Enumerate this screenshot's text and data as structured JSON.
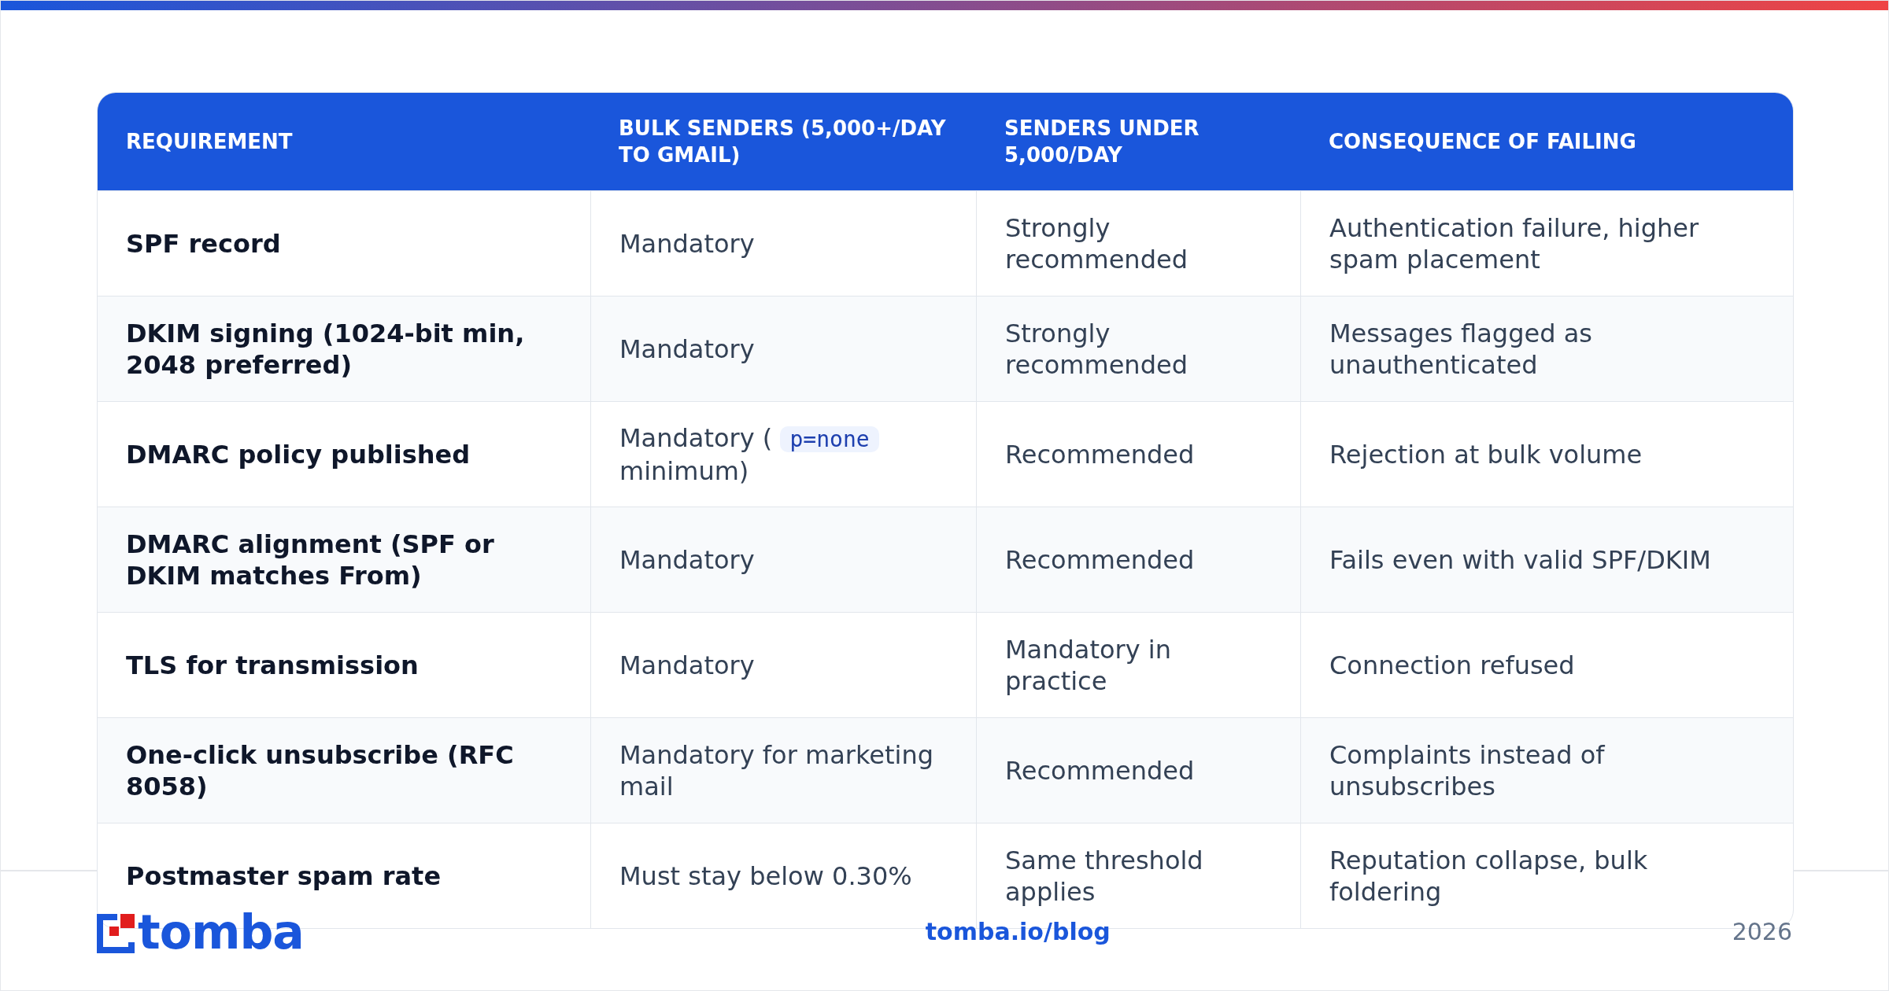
{
  "table": {
    "columns": [
      "REQUIREMENT",
      "BULK SENDERS (5,000+/DAY TO GMAIL)",
      "SENDERS UNDER 5,000/DAY",
      "CONSEQUENCE OF FAILING"
    ],
    "rows": [
      {
        "cells": [
          "SPF record",
          "Mandatory",
          "Strongly recommended",
          "Authentication failure, higher spam placement"
        ]
      },
      {
        "cells": [
          "DKIM signing (1024-bit min, 2048 preferred)",
          "Mandatory",
          "Strongly recommended",
          "Messages flagged as unauthenticated"
        ]
      },
      {
        "cells": [
          "DMARC policy published",
          {
            "kind": "inline_code",
            "before": "Mandatory (",
            "code": "p=none",
            "after": "minimum)"
          },
          "Recommended",
          "Rejection at bulk volume"
        ]
      },
      {
        "cells": [
          "DMARC alignment (SPF or DKIM matches From)",
          "Mandatory",
          "Recommended",
          "Fails even with valid SPF/DKIM"
        ]
      },
      {
        "cells": [
          "TLS for transmission",
          "Mandatory",
          "Mandatory in practice",
          "Connection refused"
        ]
      },
      {
        "cells": [
          "One-click unsubscribe (RFC 8058)",
          "Mandatory for marketing mail",
          "Recommended",
          "Complaints instead of unsubscribes"
        ]
      },
      {
        "cells": [
          "Postmaster spam rate",
          "Must stay below 0.30%",
          "Same threshold applies",
          "Reputation collapse, bulk foldering"
        ]
      }
    ]
  },
  "footer": {
    "logo": "tomba",
    "link": "tomba.io/blog",
    "year": "2026"
  }
}
